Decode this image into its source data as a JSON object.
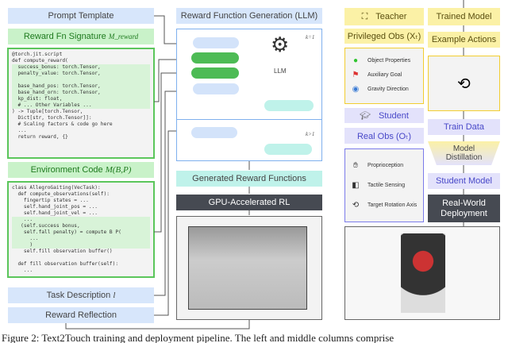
{
  "left": {
    "prompt_template": "Prompt Template",
    "reward_signature": "Reward Fn Signature",
    "reward_signature_symbol": "M_reward",
    "reward_code_top": "@torch.jit.script\ndef compute_reward(",
    "reward_code_mid": "  success_bonus: torch.Tensor,\n  penalty_value: torch.Tensor,\n\n  base_hand_pos: torch.Tensor,\n  base_hand_orn: torch.Tensor,\n  kp_dist: float,\n  # ... Other Variables ...",
    "reward_code_bot": ") -> Tuple[torch.Tensor,\n  Dict[str, torch.Tensor]]:\n  # Scaling factors & code go here\n  ...\n  return reward, {}",
    "env_code": "Environment Code",
    "env_code_symbol": "M(B,P)",
    "env_code_top": "class AllegroGaiting(VecTask):\n  def compute_observations(self):\n    fingertip states = ...\n    self.hand_joint_pos = ...\n    self.hand_joint_vel = ...",
    "env_code_mid": "    ...\n   (self.success bonus,\n    self.fall penalty) = compute B P(\n      ...\n      )",
    "env_code_bot": "    self.fill observation buffer()\n\n  def fill observation buffer(self):\n    ...",
    "task_description": "Task Description",
    "task_description_symbol": "l",
    "reward_reflection": "Reward Reflection"
  },
  "middle": {
    "title": "Reward Function Generation (LLM)",
    "llm_label": "LLM",
    "k1": "k=1",
    "k_gt1": "k>1",
    "generated": "Generated Reward Functions",
    "gpu_rl": "GPU-Accelerated RL"
  },
  "right": {
    "teacher": "Teacher",
    "privileged_obs": "Privileged Obs (Xₜ)",
    "privileged_items": [
      "Object Properties",
      "Auxiliary Goal",
      "Gravity Direction"
    ],
    "student": "Student",
    "real_obs": "Real Obs (Oₜ)",
    "real_items": [
      "Proprioception",
      "Tactile Sensing",
      "Target Rotation Axis"
    ],
    "trained_model": "Trained Model",
    "example_actions": "Example Actions",
    "train_data": "Train Data",
    "distillation": "Model Distillation",
    "student_model": "Student Model",
    "deployment": "Real-World Deployment"
  },
  "caption": "Figure 2: Text2Touch training and deployment pipeline. The left and middle columns comprise",
  "colors": {
    "green": "#5bc65b",
    "blue": "#d7e6fb",
    "yellow": "#fbf1a6",
    "purple": "#e3e2fb",
    "teal": "#bff2ea",
    "dark": "#464a52"
  }
}
